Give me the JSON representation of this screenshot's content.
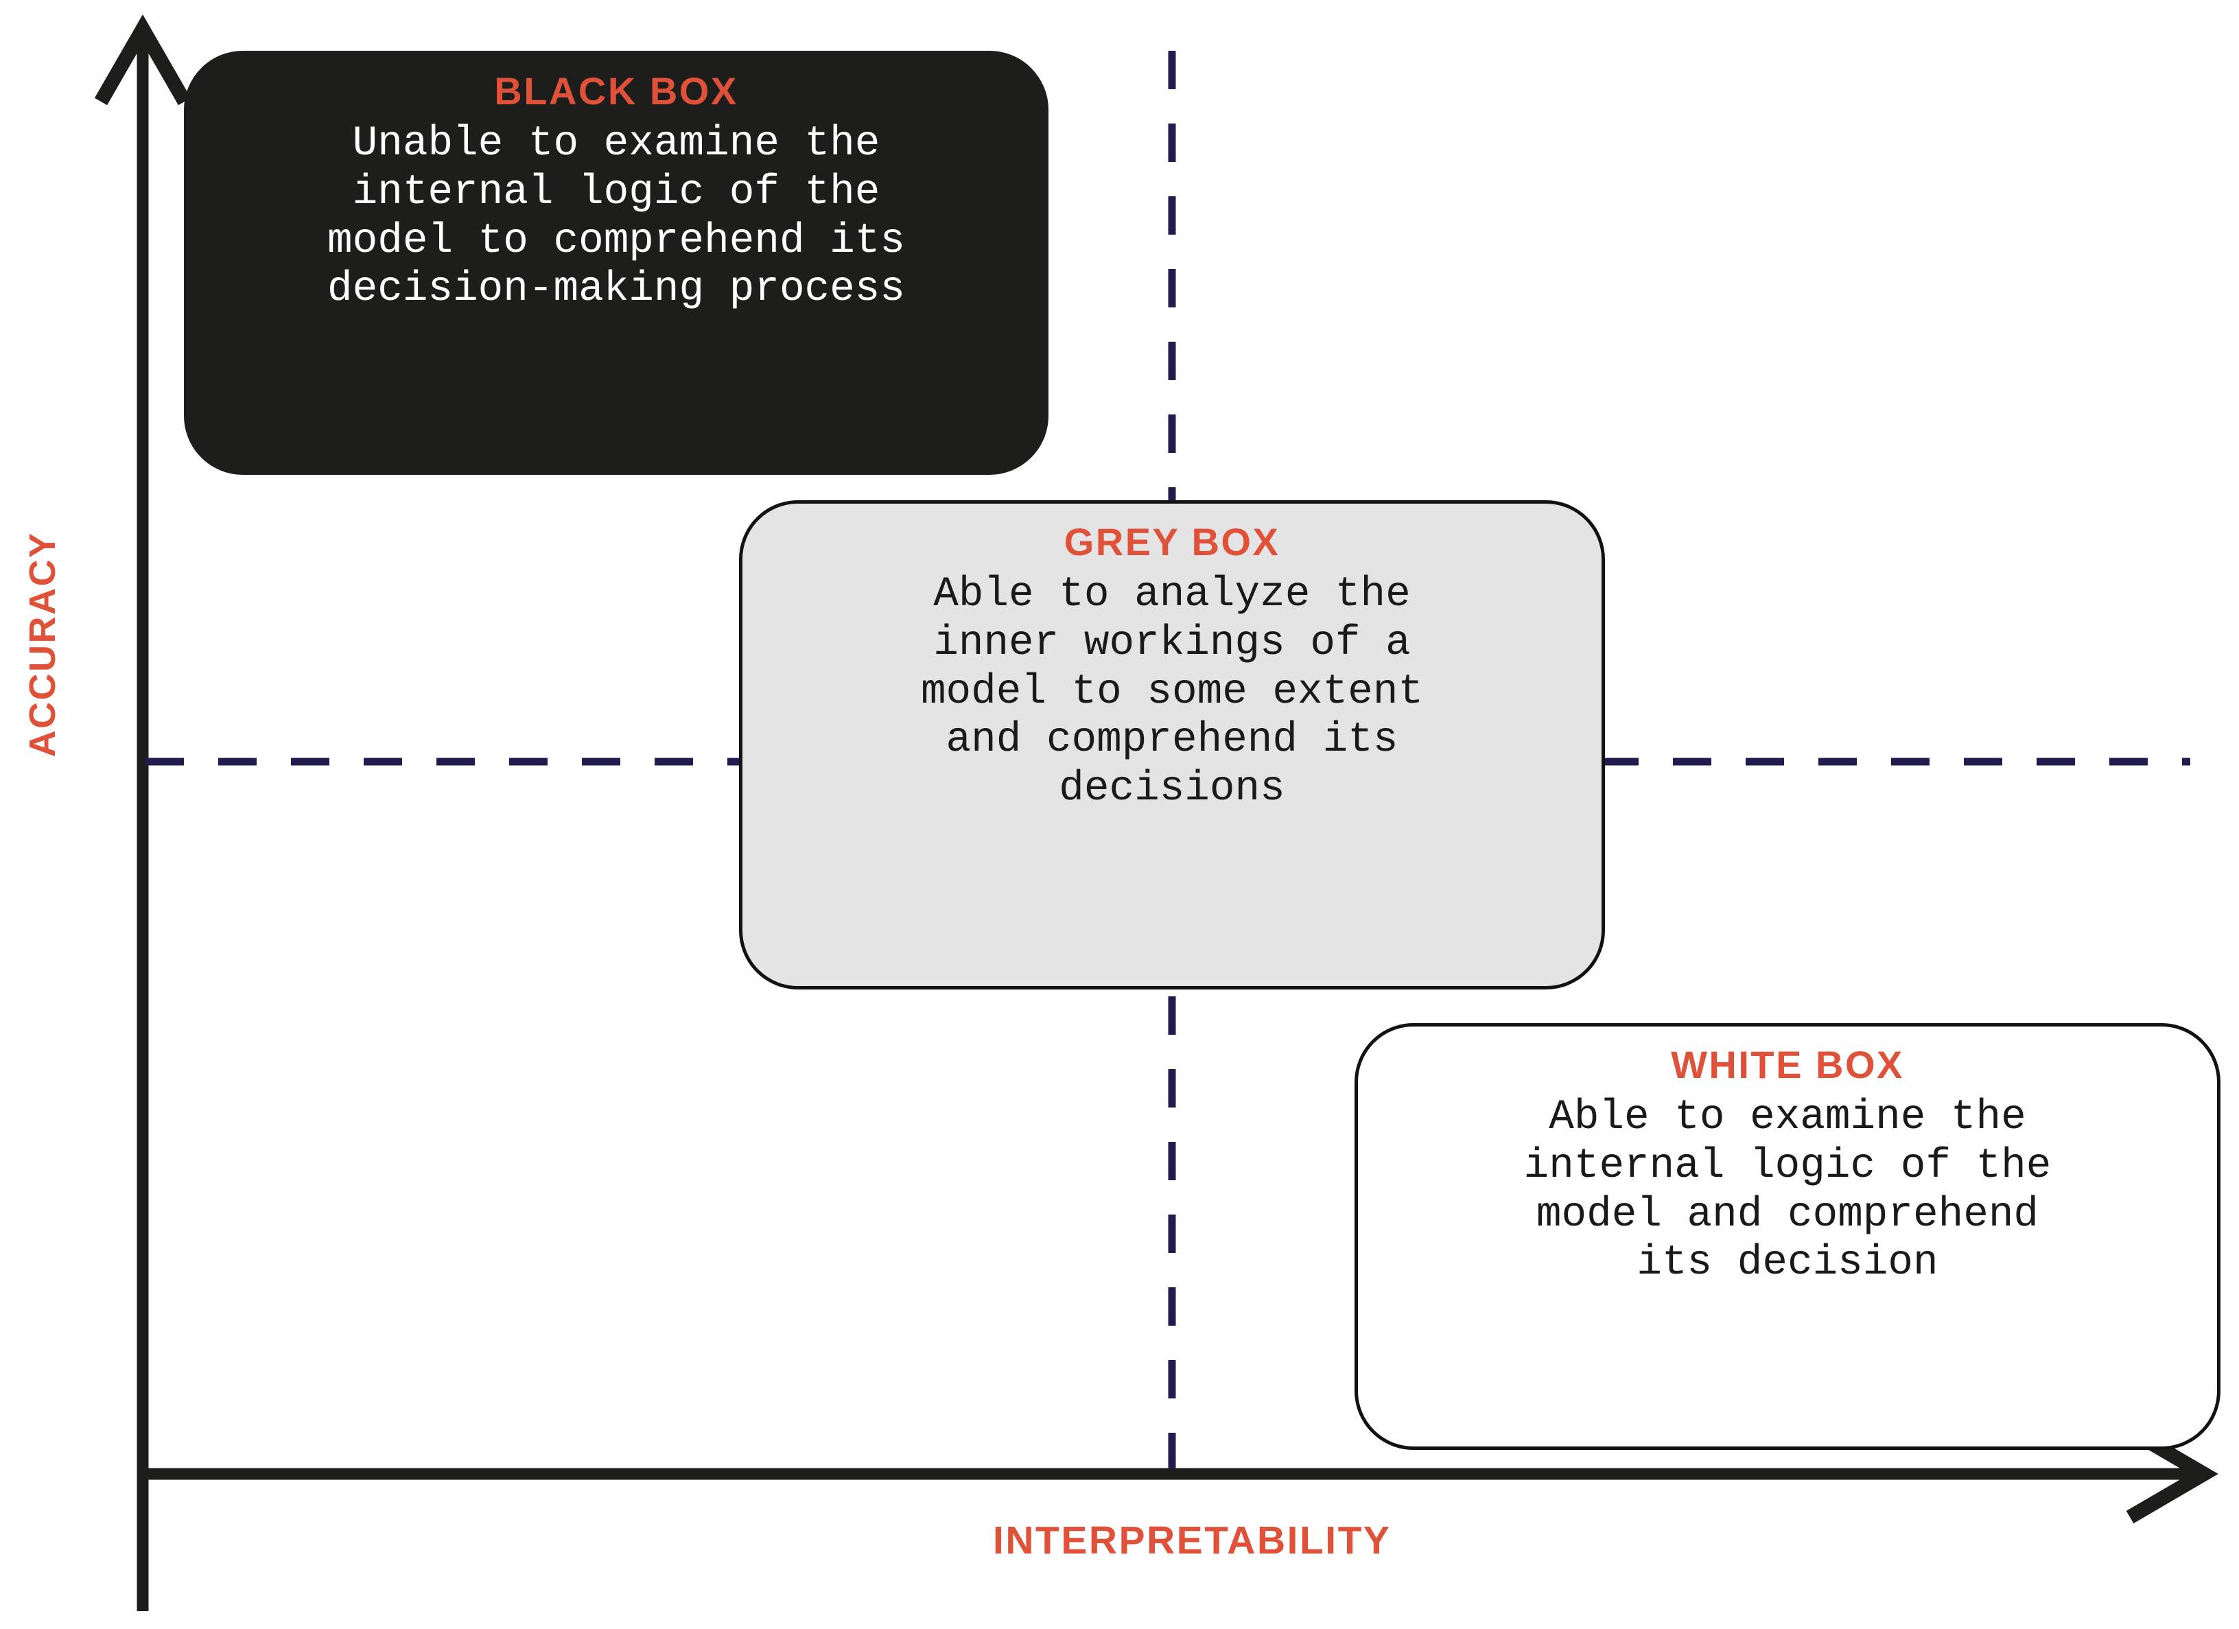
{
  "figure": {
    "y_axis_label": "ACCURACY",
    "x_axis_label": "INTERPRETABILITY"
  },
  "colors": {
    "accent_orange": "#DF5138",
    "axis_black": "#1D1D1B",
    "dashed_navy": "#221B4D",
    "grey_box_fill": "#E4E4E4",
    "black_box_fill": "#1D1D1B",
    "white_box_fill": "#FFFFFF"
  },
  "boxes": {
    "black": {
      "title": "BLACK BOX",
      "body": "Unable to examine the\ninternal logic of the\nmodel to comprehend its\ndecision-making process"
    },
    "grey": {
      "title": "GREY BOX",
      "body": "Able to analyze the\ninner workings of a\nmodel to some extent\nand comprehend its\ndecisions"
    },
    "white": {
      "title": "WHITE BOX",
      "body": "Able to examine the\ninternal logic of the\nmodel and comprehend\nits decision"
    }
  },
  "chart_data": {
    "type": "scatter",
    "title": "",
    "xlabel": "INTERPRETABILITY",
    "ylabel": "ACCURACY",
    "grid": false,
    "legend": "none",
    "xlim": [
      0,
      1
    ],
    "ylim": [
      0,
      1
    ],
    "quadrant_dividers": {
      "vertical_x": 0.5,
      "horizontal_y": 0.5,
      "style": "dashed",
      "color": "#221B4D"
    },
    "categories": [
      "BLACK BOX",
      "GREY BOX",
      "WHITE BOX"
    ],
    "series": [
      {
        "name": "Model transparency categories",
        "points": [
          {
            "label": "BLACK BOX",
            "interpretability": 0.12,
            "accuracy": 0.88
          },
          {
            "label": "GREY BOX",
            "interpretability": 0.5,
            "accuracy": 0.5
          },
          {
            "label": "WHITE BOX",
            "interpretability": 0.85,
            "accuracy": 0.15
          }
        ]
      }
    ],
    "annotations": [
      "Unable to examine the internal logic of the model to comprehend its decision-making process",
      "Able to analyze the inner workings of a model to some extent and comprehend its decisions",
      "Able to examine the internal logic of the model and comprehend its decision"
    ]
  }
}
